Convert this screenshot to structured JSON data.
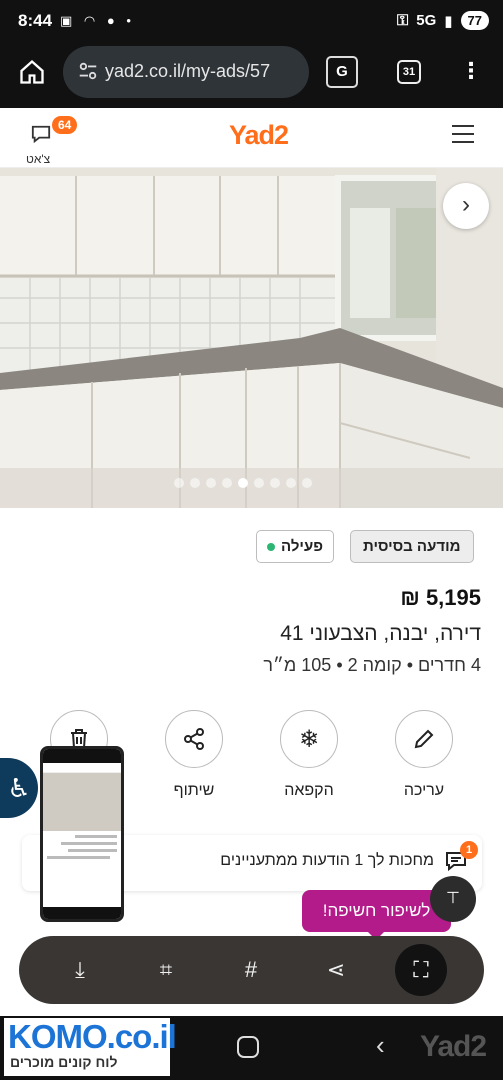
{
  "status_bar": {
    "time": "8:44",
    "network": "5G",
    "battery": "77"
  },
  "browser": {
    "url": "yad2.co.il/my-ads/57",
    "tabs_count": "31"
  },
  "header": {
    "logo": "Yad2",
    "chat_label": "צ'אט",
    "chat_badge": "64"
  },
  "gallery": {
    "dot_count": 9,
    "active_index": 4
  },
  "listing": {
    "tag_basic": "מודעה בסיסית",
    "tag_active": "פעילה",
    "price": "5,195 ₪",
    "address": "דירה, יבנה, הצבעוני 41",
    "specs": "4 חדרים  •  קומה 2  •  105 מ״ר"
  },
  "actions": [
    {
      "key": "edit",
      "label": "עריכה",
      "icon": "pencil-icon"
    },
    {
      "key": "freeze",
      "label": "הקפאה",
      "icon": "snowflake-icon"
    },
    {
      "key": "share",
      "label": "שיתוף",
      "icon": "share-icon"
    },
    {
      "key": "delete",
      "label": "",
      "icon": "trash-icon"
    }
  ],
  "interests": {
    "text": "מחכות לך 1 הודעות ממתעניינים",
    "badge": "1"
  },
  "promo": {
    "text": "לשיפור חשיפה!"
  },
  "toolbar": [
    "scan-icon",
    "crop-edit-icon",
    "hashtag-icon",
    "share-icon",
    "smart-select-icon"
  ],
  "navbar": {
    "ad_title": "KOMO.co.il",
    "ad_sub": "לוח קונים מוכרים",
    "watermark": "Yad2"
  },
  "colors": {
    "brand": "#ff6e1a",
    "promo": "#b31a8a",
    "accessibility": "#0e3a5b",
    "active_dot": "#2bb673"
  }
}
